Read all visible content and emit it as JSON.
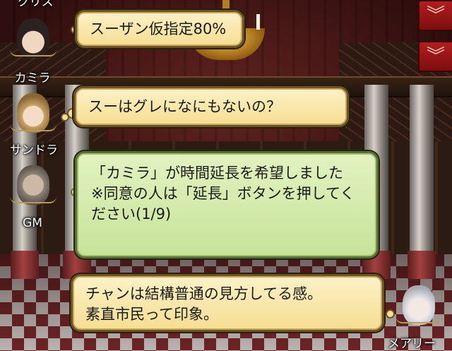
{
  "characters": {
    "top": {
      "name": "クリス"
    },
    "camilla": {
      "name": "カミラ"
    },
    "sandra": {
      "name": "サンドラ"
    },
    "gm": {
      "name": "GM"
    },
    "mary": {
      "name": "メアリー"
    }
  },
  "messages": [
    {
      "speaker": "カミラ",
      "text": "スーザン仮指定80%"
    },
    {
      "speaker": "サンドラ",
      "text": "スーはグレになにもないの？"
    },
    {
      "speaker": "GM",
      "text": "「カミラ」が時間延長を希望しました\n※同意の人は「延長」ボタンを押してください(1/9)"
    },
    {
      "speaker": "メアリー",
      "text": "チャンは結構普通の見方してる感。\n素直市民って印象。"
    }
  ],
  "controls": {
    "scroll_up_icon": "double-chevron-down-icon",
    "scroll_down_icon": "double-chevron-down-icon"
  },
  "colors": {
    "system_bubble": "#c7e39a",
    "player_bubble": "#f5dd93",
    "button_red": "#b11e1e"
  }
}
